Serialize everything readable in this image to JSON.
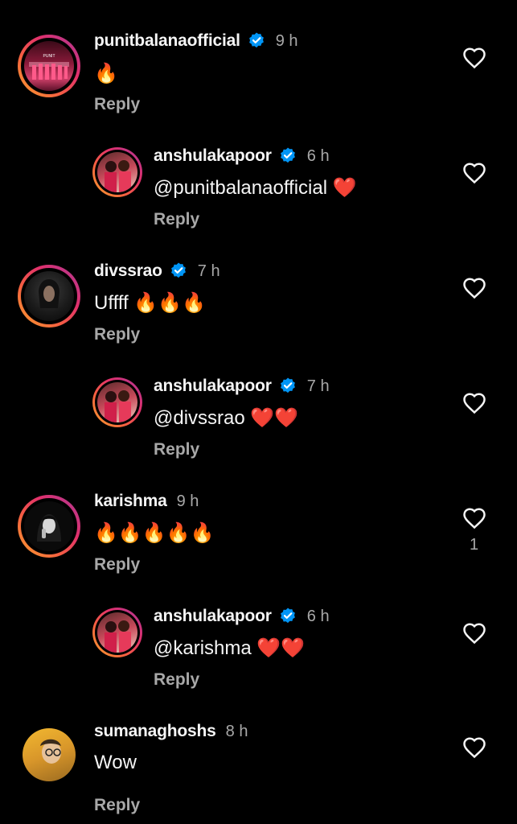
{
  "comments": [
    {
      "username": "punitbalanaofficial",
      "time": "9 h",
      "text": "🔥",
      "reply": "Reply",
      "verified": true,
      "likes": ""
    },
    {
      "username": "anshulakapoor",
      "time": "6 h",
      "text": "@punitbalanaofficial ❤️",
      "reply": "Reply",
      "verified": true,
      "likes": ""
    },
    {
      "username": "divssrao",
      "time": "7 h",
      "text": "Uffff 🔥🔥🔥",
      "reply": "Reply",
      "verified": true,
      "likes": ""
    },
    {
      "username": "anshulakapoor",
      "time": "7 h",
      "text": "@divssrao ❤️❤️",
      "reply": "Reply",
      "verified": true,
      "likes": ""
    },
    {
      "username": "karishma",
      "time": "9 h",
      "text": "🔥🔥🔥🔥🔥",
      "reply": "Reply",
      "verified": false,
      "likes": "1"
    },
    {
      "username": "anshulakapoor",
      "time": "6 h",
      "text": "@karishma ❤️❤️",
      "reply": "Reply",
      "verified": true,
      "likes": ""
    },
    {
      "username": "sumanaghoshs",
      "time": "8 h",
      "text": "Wow",
      "reply": "Reply",
      "verified": false,
      "likes": ""
    }
  ],
  "colors": {
    "verified": "#0095f6",
    "secondary_text": "#a8a8a8",
    "background": "#000000"
  },
  "icons": {
    "like": "heart-outline-icon",
    "verified": "verified-badge-icon"
  }
}
